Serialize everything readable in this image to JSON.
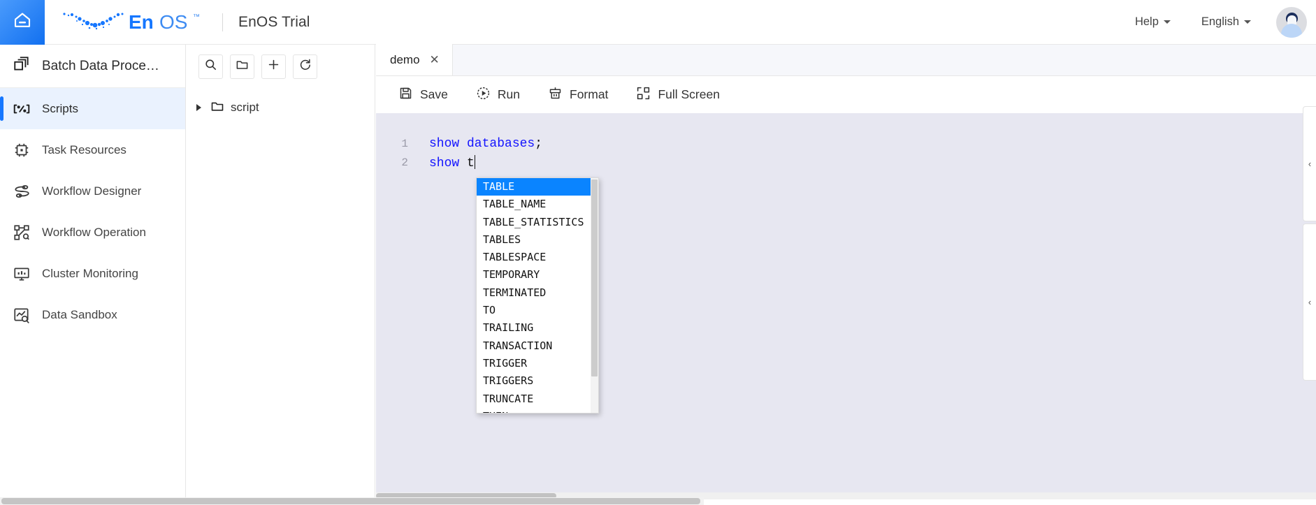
{
  "header": {
    "home_icon": "home-icon",
    "logo_text_bold": "En",
    "logo_text_light": "OS",
    "logo_tm": "™",
    "trial_title": "EnOS Trial",
    "help_label": "Help",
    "language_label": "English",
    "avatar_icon": "user-avatar-icon",
    "accent_color": "#1677ff"
  },
  "sidebar": {
    "app_title": "Batch Data Proce…",
    "app_icon": "layers-icon",
    "items": [
      {
        "label": "Scripts",
        "icon": "code-brackets-icon",
        "active": true
      },
      {
        "label": "Task Resources",
        "icon": "chip-icon",
        "active": false
      },
      {
        "label": "Workflow Designer",
        "icon": "workflow-icon",
        "active": false
      },
      {
        "label": "Workflow Operation",
        "icon": "workflow-nodes-icon",
        "active": false
      },
      {
        "label": "Cluster Monitoring",
        "icon": "monitor-icon",
        "active": false
      },
      {
        "label": "Data Sandbox",
        "icon": "chart-search-icon",
        "active": false
      }
    ],
    "active_bar_color": "#1677ff",
    "active_bg_color": "#eaf2fe"
  },
  "explorer": {
    "toolbar": [
      {
        "icon": "search-icon",
        "name": "search-button"
      },
      {
        "icon": "folder-icon",
        "name": "new-folder-button"
      },
      {
        "icon": "plus-icon",
        "name": "new-file-button"
      },
      {
        "icon": "refresh-icon",
        "name": "refresh-button"
      }
    ],
    "tree": [
      {
        "label": "script",
        "icon": "folder-icon",
        "expanded": false
      }
    ]
  },
  "editor": {
    "tabs": [
      {
        "label": "demo",
        "close_icon": "close-icon",
        "active": true
      }
    ],
    "toolbar": [
      {
        "label": "Save",
        "icon": "save-icon"
      },
      {
        "label": "Run",
        "icon": "run-icon"
      },
      {
        "label": "Format",
        "icon": "format-brush-icon"
      },
      {
        "label": "Full Screen",
        "icon": "fullscreen-icon"
      }
    ],
    "background_color": "#e7e7f1",
    "keyword_color": "#1414ff",
    "lines": [
      {
        "number": "1",
        "keyword": "show databases",
        "punct": ";"
      },
      {
        "number": "2",
        "keyword": "show ",
        "punct": "t",
        "caret": true
      }
    ]
  },
  "autocomplete": {
    "selected_index": 0,
    "highlight_color": "#0a84ff",
    "items": [
      "TABLE",
      "TABLE_NAME",
      "TABLE_STATISTICS",
      "TABLES",
      "TABLESPACE",
      "TEMPORARY",
      "TERMINATED",
      "TO",
      "TRAILING",
      "TRANSACTION",
      "TRIGGER",
      "TRIGGERS",
      "TRUNCATE",
      "THEN"
    ]
  },
  "right_panels": [
    {
      "label": "‹",
      "name": "collapse-panel-toggle-top"
    },
    {
      "label": "‹",
      "name": "collapse-panel-toggle-bottom"
    }
  ]
}
